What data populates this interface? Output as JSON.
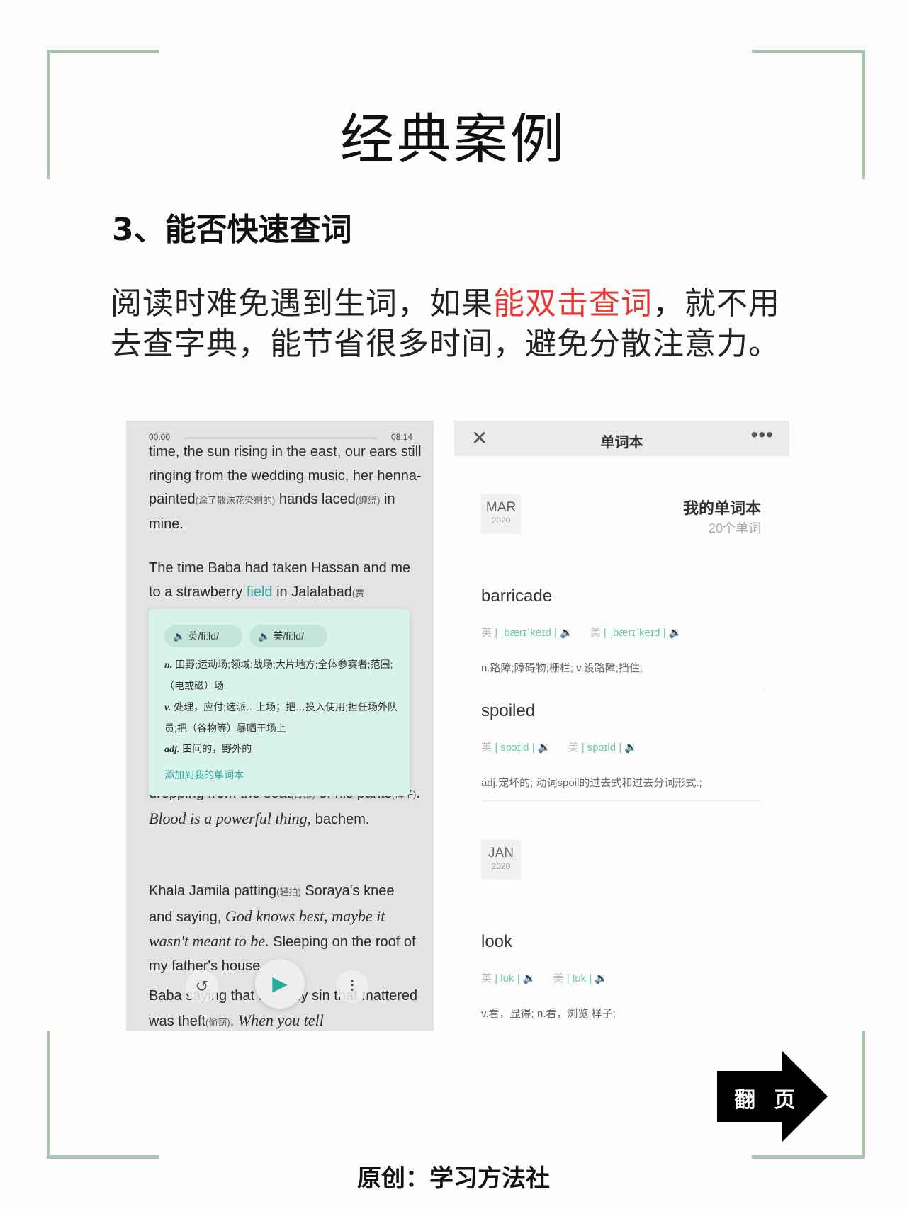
{
  "page": {
    "title": "经典案例",
    "subtitle": "3、能否快速查词",
    "intro": {
      "before": "阅读时难免遇到生词，如果",
      "highlight": "能双击查词",
      "after": "，就不用去查字典，能节省很多时间，避免分散注意力。"
    },
    "highlight_color": "#e53935",
    "frame_color": "#a9c5b2",
    "footer": "原创：学习方法社",
    "next_label": "翻 页"
  },
  "reader": {
    "time_start": "00:00",
    "time_end": "08:14",
    "p1": {
      "text": "time, the sun rising in the east, our ears still ringing from the wedding music, her henna-painted",
      "gloss1": "(涂了散沫花染剂的)",
      "mid": " hands laced",
      "gloss2": "(缠绕)",
      "end": " in mine."
    },
    "p2": {
      "text": "The time Baba had taken Hassan and me to a strawberry ",
      "link": "field",
      "end": " in Jalalabad",
      "gloss": "(贾"
    },
    "p3": {
      "a": "dropping from the seat",
      "g1": "(臀部)",
      "b": " of his pants",
      "g2": "(裤子)",
      "c": ". ",
      "italic": "Blood is a powerful thing,",
      "d": " bachem."
    },
    "p4": {
      "a": "Khala Jamila patting",
      "g1": "(轻拍)",
      "b": " Soraya's knee and saying, ",
      "italic": "God knows best, maybe it wasn't meant to be.",
      "c": " Sleeping on the roof of my father's house."
    },
    "p5": {
      "a": "Baba saying that the only sin that mattered was theft",
      "g1": "(偷窃)",
      "b": ". ",
      "italic": "When you tell"
    },
    "popup": {
      "uk": "英/fiːld/",
      "us": "美/fiːld/",
      "def1_pos": "n.",
      "def1": " 田野;运动场;领域;战场;大片地方;全体参赛者;范围;（电或磁）场",
      "def2_pos": "v.",
      "def2": " 处理，应付;选派…上场；把…投入使用;担任场外队员;把（谷物等）暴晒于场上",
      "def3_pos": "adj.",
      "def3": " 田间的，野外的",
      "add": "添加到我的单词本"
    },
    "controls": [
      "rewind-icon",
      "play-icon",
      "settings-icon"
    ],
    "accent": "#2aa7a0"
  },
  "vocab": {
    "close": "✕",
    "title": "单词本",
    "more": "•••",
    "group1": {
      "month": "MAR",
      "year": "2020"
    },
    "group2": {
      "month": "JAN",
      "year": "2020"
    },
    "book_name": "我的单词本",
    "book_count": "20个单词",
    "words": [
      {
        "word": "barricade",
        "uk_label": "英",
        "uk": "| ˌbærɪˈkeɪd |",
        "us_label": "美",
        "us": "| ˌbærɪˈkeɪd |",
        "def": "n.路障;障碍物;栅栏; v.设路障;挡住;"
      },
      {
        "word": "spoiled",
        "uk_label": "英",
        "uk": "| spɔɪld |",
        "us_label": "美",
        "us": "| spɔɪld |",
        "def": "adj.宠坏的; 动词spoil的过去式和过去分词形式.;"
      },
      {
        "word": "look",
        "uk_label": "英",
        "uk": "| lʊk |",
        "us_label": "美",
        "us": "| lʊk |",
        "def": "v.看，显得; n.看，浏览;样子;"
      }
    ],
    "phonetic_color": "#6cc7b4"
  }
}
